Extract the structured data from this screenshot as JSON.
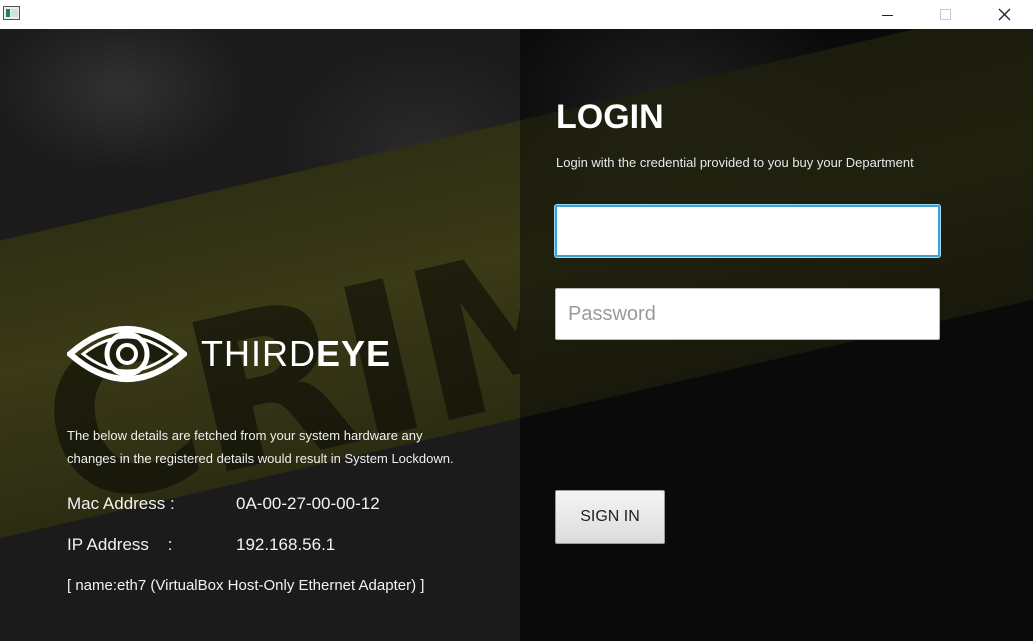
{
  "window": {
    "icon": "app-icon",
    "controls": {
      "minimize": "minimize-icon",
      "maximize": "maximize-icon",
      "close": "close-icon",
      "close_glyph": "✕"
    }
  },
  "background": {
    "icon": "crime-scene-tape-photo",
    "tape_text": "CRIME"
  },
  "brand": {
    "logo_icon": "eye-logo-icon",
    "name_light": "THIRD",
    "name_bold": "EYE"
  },
  "hardware_info": {
    "notice": "The below details are fetched from your system hardware any changes in the registered details would result in System Lockdown.",
    "mac_label": "Mac Address :",
    "mac_value": "0A-00-27-00-00-12",
    "ip_label": "IP Address    :",
    "ip_value": "192.168.56.1",
    "adapter": "[ name:eth7 (VirtualBox Host-Only Ethernet Adapter) ]"
  },
  "login": {
    "title": "LOGIN",
    "subtitle": "Login with the credential provided to you buy your Department",
    "username_value": "",
    "username_placeholder": "",
    "password_placeholder": "Password",
    "signin_label": "SIGN IN"
  },
  "colors": {
    "focus_border": "#3aa3d8",
    "text_light": "#ffffff",
    "panel_dark": "#0a0a0a",
    "tape": "#3a3a17"
  }
}
